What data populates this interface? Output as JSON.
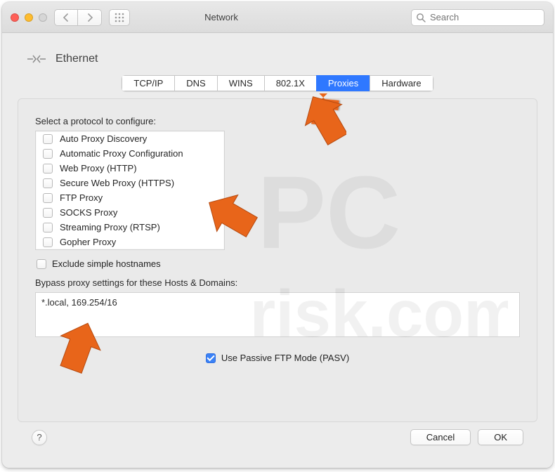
{
  "window": {
    "title": "Network"
  },
  "toolbar": {
    "search_placeholder": "Search"
  },
  "header": {
    "device_name": "Ethernet"
  },
  "tabs": [
    {
      "id": "tcpip",
      "label": "TCP/IP",
      "active": false
    },
    {
      "id": "dns",
      "label": "DNS",
      "active": false
    },
    {
      "id": "wins",
      "label": "WINS",
      "active": false
    },
    {
      "id": "8021x",
      "label": "802.1X",
      "active": false
    },
    {
      "id": "proxies",
      "label": "Proxies",
      "active": true
    },
    {
      "id": "hardware",
      "label": "Hardware",
      "active": false
    }
  ],
  "labels": {
    "select_protocol": "Select a protocol to configure:",
    "exclude_hostnames": "Exclude simple hostnames",
    "bypass_heading": "Bypass proxy settings for these Hosts & Domains:",
    "pasv": "Use Passive FTP Mode (PASV)"
  },
  "protocols": [
    {
      "id": "auto-discovery",
      "label": "Auto Proxy Discovery",
      "checked": false
    },
    {
      "id": "auto-config",
      "label": "Automatic Proxy Configuration",
      "checked": false
    },
    {
      "id": "http",
      "label": "Web Proxy (HTTP)",
      "checked": false
    },
    {
      "id": "https",
      "label": "Secure Web Proxy (HTTPS)",
      "checked": false
    },
    {
      "id": "ftp",
      "label": "FTP Proxy",
      "checked": false
    },
    {
      "id": "socks",
      "label": "SOCKS Proxy",
      "checked": false
    },
    {
      "id": "rtsp",
      "label": "Streaming Proxy (RTSP)",
      "checked": false
    },
    {
      "id": "gopher",
      "label": "Gopher Proxy",
      "checked": false
    }
  ],
  "exclude_simple_hostnames_checked": false,
  "bypass_value": "*.local, 169.254/16",
  "pasv_checked": true,
  "footer": {
    "help": "?",
    "cancel": "Cancel",
    "ok": "OK"
  }
}
